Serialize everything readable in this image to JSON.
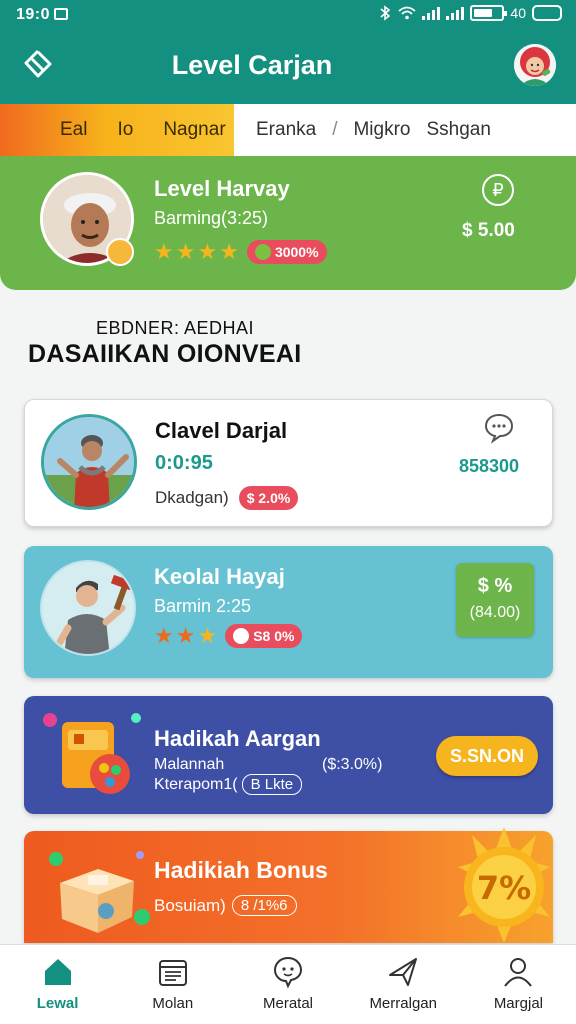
{
  "status_bar": {
    "time": "19:0",
    "right_text": "40"
  },
  "header": {
    "title": "Level Carjan"
  },
  "category_strip": {
    "left_items": [
      "Eal",
      "Io",
      "Nagnar"
    ],
    "right_items": [
      "Eranka",
      "Migkro",
      "Sshgan"
    ],
    "separator": "/"
  },
  "profile": {
    "name": "Level Harvay",
    "subtitle": "Barming(3:25)",
    "rating_stars": 4,
    "badge": "3000%",
    "price": "$ 5.00"
  },
  "section": {
    "small_heading": "EBDNER: AEDHAI",
    "heading": "DASAIIKAN OIONVEAI"
  },
  "cards": [
    {
      "title": "Clavel Darjal",
      "time": "0:0:95",
      "subtitle": "Dkadgan)",
      "badge": "$ 2.0%",
      "amount": "858300"
    },
    {
      "title": "Keolal Hayaj",
      "subtitle": "Barmin 2:25",
      "rating_stars": 3,
      "badge": "S8 0%",
      "box_top": "$ %",
      "box_bottom": "(84.00)"
    },
    {
      "title": "Hadikah Aargan",
      "line1": "Malannah",
      "line2": "Kterapom1(",
      "tag": "B Lkte",
      "amount": "($:3.0%)",
      "button": "S.SN.ON"
    },
    {
      "title": "Hadikiah Bonus",
      "subtitle": "Bosuiam)",
      "tag": "8 /1%6",
      "sun_label": "7%"
    }
  ],
  "bottom_nav": [
    {
      "label": "Lewal",
      "icon": "home-icon",
      "active": true
    },
    {
      "label": "Molan",
      "icon": "calendar-icon",
      "active": false
    },
    {
      "label": "Meratal",
      "icon": "chat-icon",
      "active": false
    },
    {
      "label": "Merralgan",
      "icon": "send-icon",
      "active": false
    },
    {
      "label": "Margjal",
      "icon": "profile-icon",
      "active": false
    }
  ],
  "colors": {
    "primary": "#13907f",
    "profile_green": "#6cb54b",
    "card_cyan": "#66c2d2",
    "card_indigo": "#3e4fa6",
    "card_orange": "#ee5a1f",
    "accent_yellow": "#f6b51e",
    "badge_red": "#e94c5c"
  }
}
